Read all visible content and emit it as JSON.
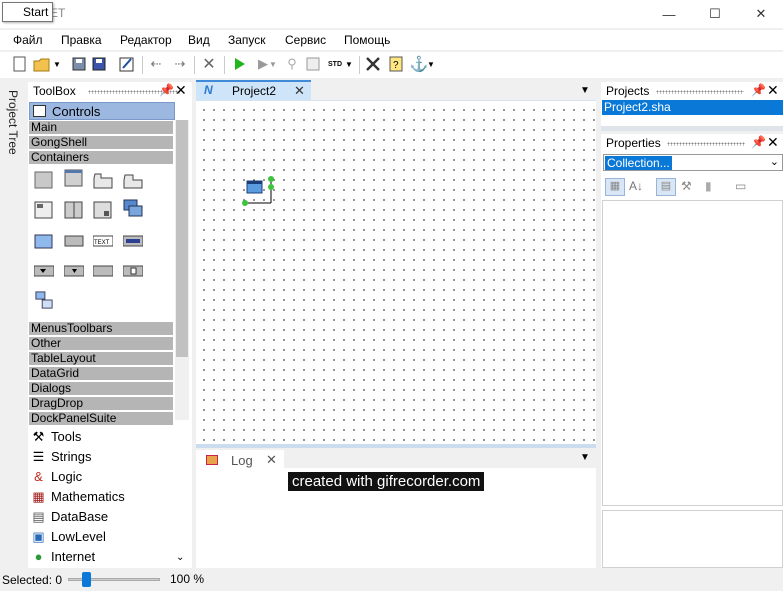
{
  "window": {
    "title": "m.NET",
    "tooltip": "Start",
    "minimize": "—",
    "maximize": "☐",
    "close": "✕"
  },
  "menu": [
    "Файл",
    "Правка",
    "Редактор",
    "Вид",
    "Запуск",
    "Сервис",
    "Помощь"
  ],
  "side_tab": "Project Tree",
  "toolbox": {
    "title": "ToolBox",
    "active_category": "Controls",
    "categories_top": [
      "Main",
      "GongShell",
      "Containers"
    ],
    "categories_bottom": [
      "MenusToolbars",
      "Other",
      "TableLayout",
      "DataGrid",
      "Dialogs",
      "DragDrop",
      "DockPanelSuite"
    ],
    "libraries": [
      {
        "label": "Tools",
        "icon": "tools-icon"
      },
      {
        "label": "Strings",
        "icon": "strings-icon"
      },
      {
        "label": "Logic",
        "icon": "logic-icon"
      },
      {
        "label": "Mathematics",
        "icon": "calculator-icon"
      },
      {
        "label": "DataBase",
        "icon": "database-icon"
      },
      {
        "label": "LowLevel",
        "icon": "lowlevel-icon"
      },
      {
        "label": "Internet",
        "icon": "globe-icon"
      }
    ]
  },
  "document": {
    "tab_label": "Project2",
    "tab_icon": "N"
  },
  "log": {
    "tab_label": "Log"
  },
  "watermark": "created with gifrecorder.com",
  "projects": {
    "title": "Projects",
    "selected": "Project2.sha"
  },
  "properties": {
    "title": "Properties",
    "selected_object": "Collection..."
  },
  "status": {
    "selected": "Selected: 0",
    "zoom": "100 %",
    "zoom_fraction": 0.2
  },
  "colors": {
    "accent": "#0a78d7",
    "category_bg": "#b5b5b5",
    "active_tab": "#cde4f9"
  }
}
